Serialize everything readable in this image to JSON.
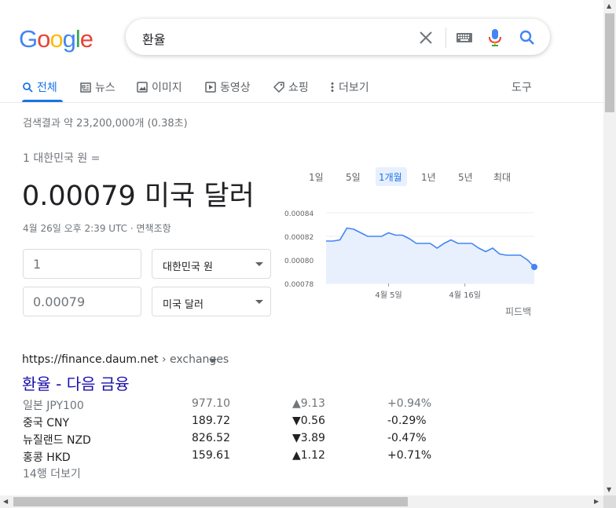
{
  "logo": {
    "letters": [
      "G",
      "o",
      "o",
      "g",
      "l",
      "e"
    ],
    "colors": [
      "#4285F4",
      "#EA4335",
      "#FBBC05",
      "#4285F4",
      "#34A853",
      "#EA4335"
    ]
  },
  "search": {
    "query": "환율"
  },
  "tabs": [
    {
      "label": "전체",
      "icon": "search-icon"
    },
    {
      "label": "뉴스",
      "icon": "news-icon"
    },
    {
      "label": "이미지",
      "icon": "image-icon"
    },
    {
      "label": "동영상",
      "icon": "video-icon"
    },
    {
      "label": "쇼핑",
      "icon": "tag-icon"
    },
    {
      "label": "더보기",
      "icon": "more-vert-icon"
    }
  ],
  "tools_label": "도구",
  "result_stats": "검색결과 약 23,200,000개 (0.38초)",
  "converter": {
    "from_label": "1 대한민국 원 =",
    "result_value": "0.00079 미국 달러",
    "timestamp": "4월 26일 오후 2:39 UTC · 면책조항",
    "amount_from": "1",
    "currency_from": "대한민국 원",
    "amount_to": "0.00079",
    "currency_to": "미국 달러"
  },
  "chart_ranges": [
    "1일",
    "5일",
    "1개월",
    "1년",
    "5년",
    "최대"
  ],
  "chart_active_range": "1개월",
  "chart_data": {
    "type": "area",
    "x": [
      "3/27",
      "3/28",
      "3/29",
      "3/30",
      "3/31",
      "4/1",
      "4/2",
      "4/3",
      "4/4",
      "4/5",
      "4/6",
      "4/7",
      "4/8",
      "4/9",
      "4/10",
      "4/11",
      "4/12",
      "4/13",
      "4/14",
      "4/15",
      "4/16",
      "4/17",
      "4/18",
      "4/19",
      "4/20",
      "4/21",
      "4/22",
      "4/23",
      "4/24",
      "4/25",
      "4/26"
    ],
    "values": [
      0.000816,
      0.000816,
      0.000817,
      0.000827,
      0.000826,
      0.000823,
      0.00082,
      0.00082,
      0.00082,
      0.000823,
      0.000821,
      0.000821,
      0.000818,
      0.000814,
      0.000814,
      0.000814,
      0.00081,
      0.000814,
      0.000817,
      0.000814,
      0.000814,
      0.000814,
      0.00081,
      0.000807,
      0.00081,
      0.000805,
      0.000804,
      0.000804,
      0.000804,
      0.0008,
      0.000794
    ],
    "y_ticks": [
      "0.00084",
      "0.00082",
      "0.00080",
      "0.00078"
    ],
    "y_tick_values": [
      0.00084,
      0.00082,
      0.0008,
      0.00078
    ],
    "ylim": [
      0.00078,
      0.00084
    ],
    "x_tick_labels": [
      {
        "label": "4월 5일",
        "at": "4/5"
      },
      {
        "label": "4월 16일",
        "at": "4/16"
      }
    ],
    "color": "#4285F4",
    "fill": "#e8f0fe",
    "grid": true
  },
  "feedback_label": "피드백",
  "result": {
    "domain": "https://finance.daum.net",
    "path": " › exchanges",
    "title": "환율 - 다음 금융",
    "rows": [
      {
        "name": "일본 JPY100",
        "value": "977.10",
        "change": "▲9.13",
        "pct": "+0.94%",
        "muted": true
      },
      {
        "name": "중국 CNY",
        "value": "189.72",
        "change": "▼0.56",
        "pct": "-0.29%",
        "muted": false
      },
      {
        "name": "뉴질랜드 NZD",
        "value": "826.52",
        "change": "▼3.89",
        "pct": "-0.47%",
        "muted": false
      },
      {
        "name": "홍콩 HKD",
        "value": "159.61",
        "change": "▲1.12",
        "pct": "+0.71%",
        "muted": false
      }
    ],
    "more_rows": "14행 더보기"
  }
}
